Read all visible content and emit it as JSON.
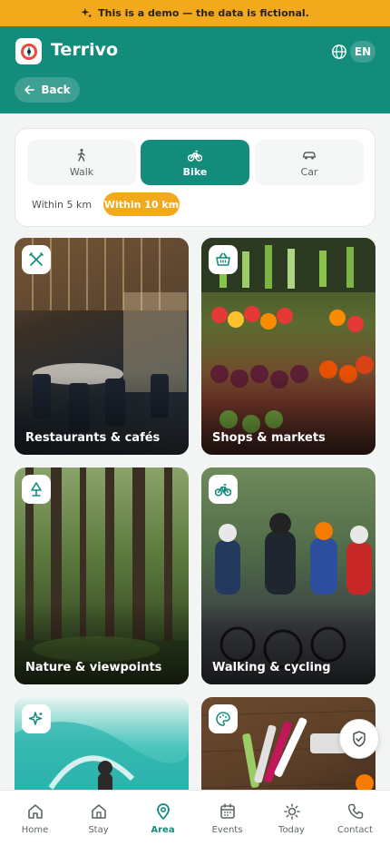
{
  "banner": {
    "icon": "sparkle-icon",
    "text": "This is a demo — the data is fictional."
  },
  "header": {
    "brand": "Terrivo",
    "language": "EN",
    "back_label": "Back"
  },
  "transport": {
    "modes": [
      {
        "label": "Walk",
        "icon": "walk-icon",
        "active": false
      },
      {
        "label": "Bike",
        "icon": "bike-icon",
        "active": true
      },
      {
        "label": "Car",
        "icon": "car-icon",
        "active": false
      }
    ],
    "distances": [
      {
        "label": "Within 5 km",
        "active": false
      },
      {
        "label": "Within 10 km",
        "active": true
      }
    ]
  },
  "categories": [
    {
      "label": "Restaurants & cafés",
      "icon": "cutlery-icon"
    },
    {
      "label": "Shops & markets",
      "icon": "basket-icon"
    },
    {
      "label": "Nature & viewpoints",
      "icon": "tree-icon"
    },
    {
      "label": "Walking & cycling",
      "icon": "bike-icon"
    },
    {
      "label": "",
      "icon": "sparkle-icon"
    },
    {
      "label": "",
      "icon": "palette-icon"
    }
  ],
  "tabs": [
    {
      "label": "Home",
      "icon": "home-icon",
      "active": false
    },
    {
      "label": "Stay",
      "icon": "house-icon",
      "active": false
    },
    {
      "label": "Area",
      "icon": "map-pin-icon",
      "active": true
    },
    {
      "label": "Events",
      "icon": "calendar-icon",
      "active": false
    },
    {
      "label": "Today",
      "icon": "sun-icon",
      "active": false
    },
    {
      "label": "Contact",
      "icon": "phone-icon",
      "active": false
    }
  ],
  "colors": {
    "primary": "#138c7c",
    "accent": "#f2a91c"
  }
}
